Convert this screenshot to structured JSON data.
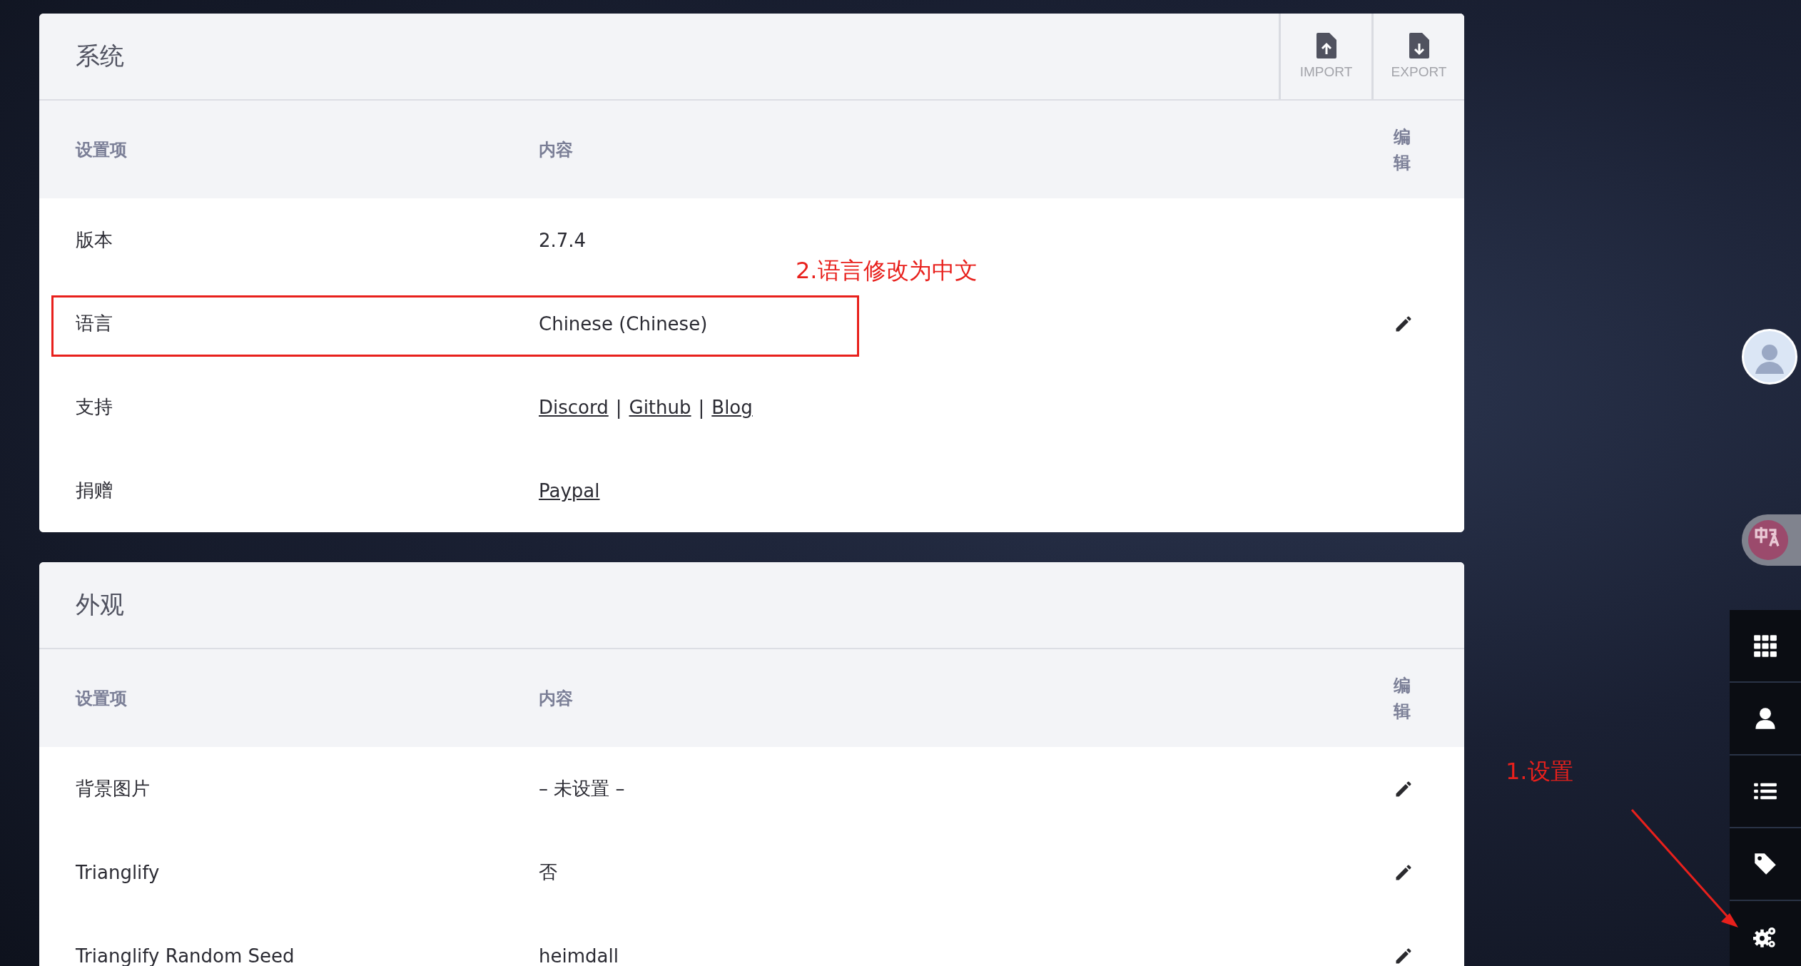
{
  "panels": [
    {
      "title": "系统",
      "actions": [
        {
          "kind": "import",
          "label": "IMPORT"
        },
        {
          "kind": "export",
          "label": "EXPORT"
        }
      ],
      "columns": [
        "设置项",
        "内容",
        "编辑"
      ],
      "rows": [
        {
          "name": "版本",
          "highlighted": false,
          "editable": false,
          "value": [
            {
              "kind": "text",
              "text": "2.7.4"
            }
          ]
        },
        {
          "name": "语言",
          "highlighted": true,
          "editable": true,
          "value": [
            {
              "kind": "text",
              "text": "Chinese (Chinese)"
            }
          ]
        },
        {
          "name": "支持",
          "highlighted": false,
          "editable": false,
          "value": [
            {
              "kind": "link",
              "text": "Discord"
            },
            {
              "kind": "text",
              "text": "|"
            },
            {
              "kind": "link",
              "text": "Github"
            },
            {
              "kind": "text",
              "text": "|"
            },
            {
              "kind": "link",
              "text": "Blog"
            }
          ]
        },
        {
          "name": "捐赠",
          "highlighted": false,
          "editable": false,
          "value": [
            {
              "kind": "link",
              "text": "Paypal"
            }
          ]
        }
      ]
    },
    {
      "title": "外观",
      "columns": [
        "设置项",
        "内容",
        "编辑"
      ],
      "rows": [
        {
          "name": "背景图片",
          "highlighted": false,
          "editable": true,
          "value": [
            {
              "kind": "text",
              "text": "– 未设置 –"
            }
          ]
        },
        {
          "name": "Trianglify",
          "highlighted": false,
          "editable": true,
          "value": [
            {
              "kind": "text",
              "text": "否"
            }
          ]
        },
        {
          "name": "Trianglify Random Seed",
          "highlighted": false,
          "editable": true,
          "value": [
            {
              "kind": "text",
              "text": "heimdall"
            }
          ]
        }
      ]
    }
  ],
  "annotations": [
    {
      "kind": "language",
      "text": "2.语言修改为中文"
    },
    {
      "kind": "settings",
      "text": "1.设置"
    }
  ],
  "dock": [
    {
      "kind": "grid"
    },
    {
      "kind": "user"
    },
    {
      "kind": "list"
    },
    {
      "kind": "tag"
    },
    {
      "kind": "settings"
    }
  ]
}
